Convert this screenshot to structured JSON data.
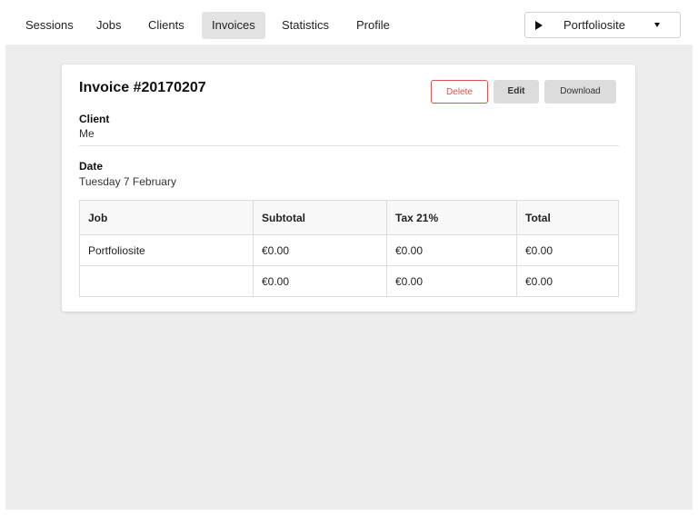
{
  "nav": {
    "items": [
      {
        "label": "Sessions"
      },
      {
        "label": "Jobs"
      },
      {
        "label": "Clients"
      },
      {
        "label": "Invoices",
        "active": true
      },
      {
        "label": "Statistics"
      },
      {
        "label": "Profile"
      }
    ],
    "session_select": {
      "value": "Portfoliosite",
      "icon": "play-icon"
    }
  },
  "invoice": {
    "title": "Invoice #20170207",
    "actions": {
      "delete": "Delete",
      "edit": "Edit",
      "download": "Download"
    },
    "client": {
      "label": "Client",
      "value": "Me"
    },
    "date": {
      "label": "Date",
      "value": "Tuesday 7 February"
    },
    "table": {
      "headers": [
        "Job",
        "Subtotal",
        "Tax 21%",
        "Total"
      ],
      "rows": [
        [
          "Portfoliosite",
          "€0.00",
          "€0.00",
          "€0.00"
        ],
        [
          "",
          "€0.00",
          "€0.00",
          "€0.00"
        ]
      ]
    }
  },
  "colors": {
    "delete": "#d9534f",
    "background": "#ededed",
    "active_tab": "#e3e3e3"
  }
}
